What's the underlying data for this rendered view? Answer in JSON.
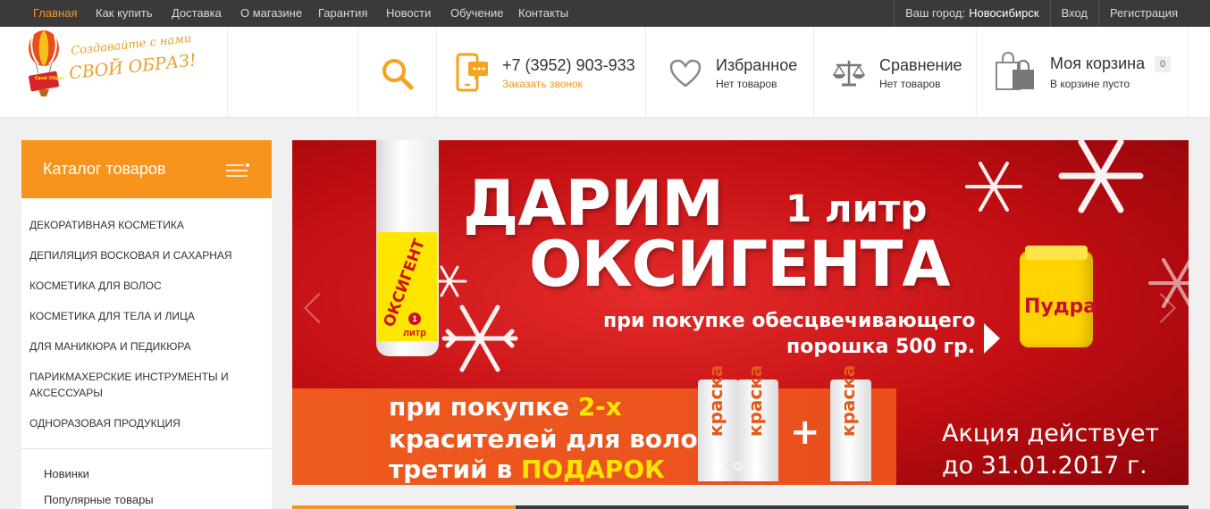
{
  "topnav": {
    "items": [
      "Главная",
      "Как купить",
      "Доставка",
      "О магазине",
      "Гарантия",
      "Новости",
      "Обучение",
      "Контакты"
    ],
    "city_label": "Ваш город:",
    "city": "Новосибирск",
    "login": "Вход",
    "register": "Регистрация"
  },
  "logo": {
    "line1": "Создавайте с нами",
    "line2": "СВОЙ ОБРАЗ!",
    "badge": "Свой Образ"
  },
  "header": {
    "phone": "+7 (3952) 903-933",
    "callback": "Заказать звонок",
    "favorites_title": "Избранное",
    "favorites_sub": "Нет товаров",
    "compare_title": "Сравнение",
    "compare_sub": "Нет товаров",
    "cart_title": "Моя корзина",
    "cart_sub": "В корзине пусто",
    "cart_count": "0"
  },
  "catalog": {
    "title": "Каталог товаров",
    "items": [
      "ДЕКОРАТИВНАЯ КОСМЕТИКА",
      "ДЕПИЛЯЦИЯ ВОСКОВАЯ И САХАРНАЯ",
      "КОСМЕТИКА ДЛЯ ВОЛОС",
      "КОСМЕТИКА ДЛЯ ТЕЛА И ЛИЦА",
      "ДЛЯ МАНИКЮРА И ПЕДИКЮРА",
      "ПАРИКМАХЕРСКИЕ ИНСТРУМЕНТЫ И АКСЕССУАРЫ",
      "ОДНОРАЗОВАЯ ПРОДУКЦИЯ"
    ],
    "sub_items": [
      "Новинки",
      "Популярные товары"
    ]
  },
  "banner": {
    "headline1": "ДАРИМ",
    "headline1b": "1 литр",
    "headline2": "ОКСИГЕНТА",
    "line3": "при покупке обесцвечивающего",
    "line4": "порошка 500 гр.",
    "bottle_label": "ОКСИГЕНТ",
    "bottle_num": "1",
    "bottle_unit": "литр",
    "jar_label": "Пудра",
    "promo_line1_a": "при покупке ",
    "promo_line1_b": "2-х",
    "promo_line2": "красителей для волос",
    "promo_line3_a": "третий в ",
    "promo_line3_b": "ПОДАРОК",
    "tube_label": "краска",
    "plus": "+",
    "akcia1": "Акция действует",
    "akcia2": "до 31.01.2017 г.",
    "active_dot": 0,
    "dot_count": 3
  },
  "colors": {
    "accent": "#f7941d",
    "topbar": "#3a3a3a",
    "banner_red": "#c10e12"
  }
}
